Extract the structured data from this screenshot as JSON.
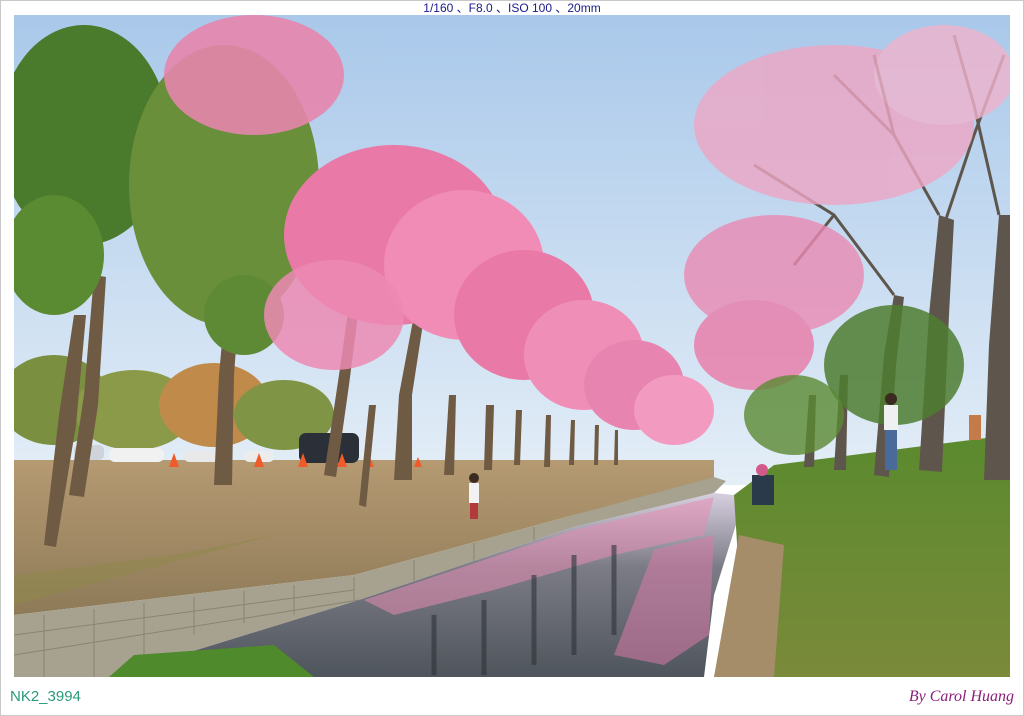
{
  "exif": "1/160 、F8.0 、ISO 100 、20mm",
  "file_id": "NK2_3994",
  "credit": "By Carol Huang",
  "colors": {
    "sky": "#b9d4ee",
    "blossom": "#e97aa8",
    "grass": "#6f9a3c",
    "water": "#6c7079",
    "wall": "#9d9a88"
  }
}
